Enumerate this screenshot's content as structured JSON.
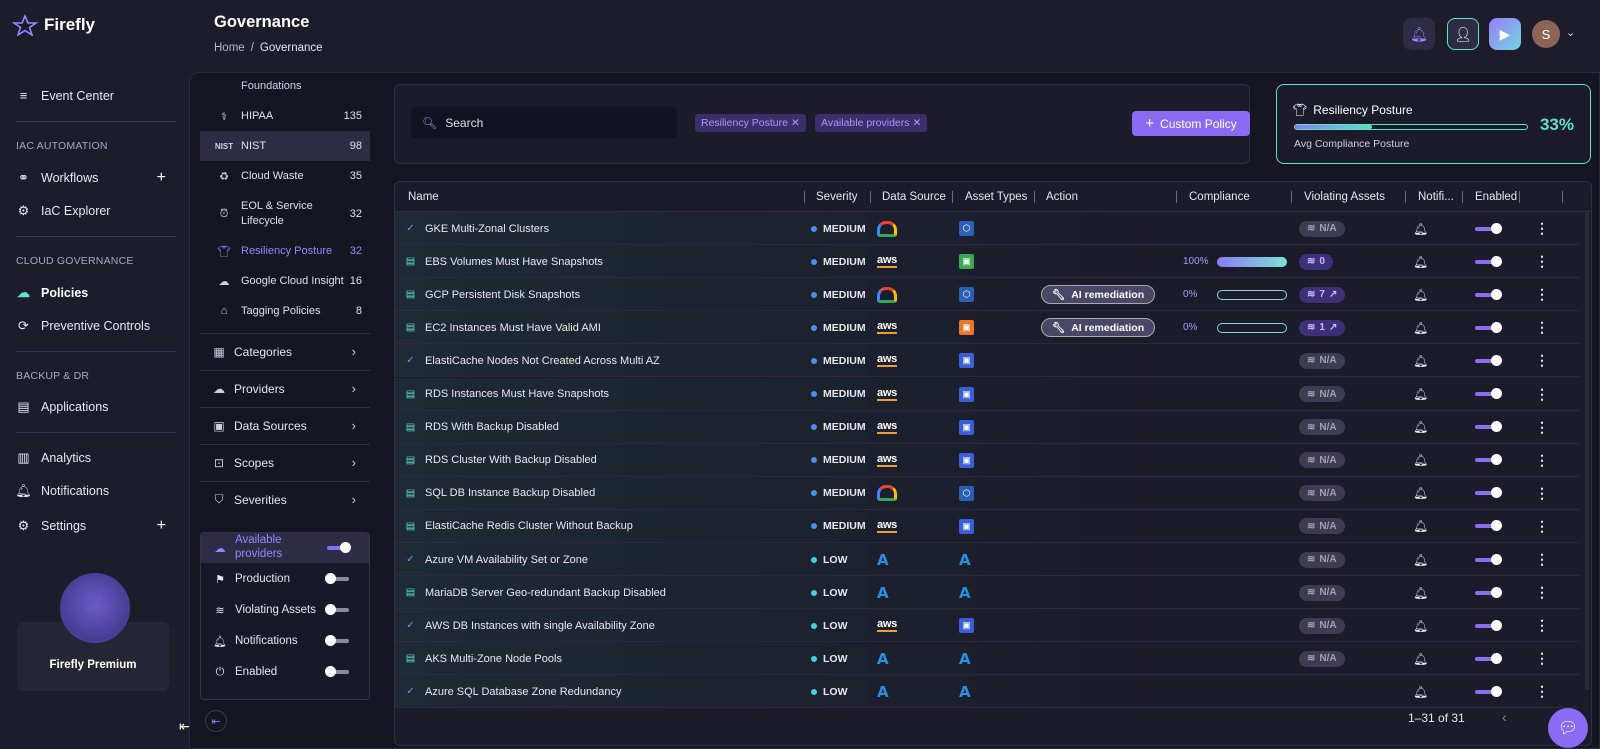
{
  "brand": {
    "name": "Firefly"
  },
  "nav": {
    "event_center": "Event Center",
    "sec_iac": "IAC AUTOMATION",
    "workflows": "Workflows",
    "iac_explorer": "IaC Explorer",
    "sec_cloud": "CLOUD GOVERNANCE",
    "policies": "Policies",
    "preventive": "Preventive Controls",
    "sec_backup": "BACKUP & DR",
    "applications": "Applications",
    "analytics": "Analytics",
    "notifications": "Notifications",
    "settings": "Settings",
    "premium": "Firefly Premium"
  },
  "header": {
    "title": "Governance",
    "crumb_home": "Home",
    "crumb_sep": "/",
    "crumb_current": "Governance",
    "avatar_letter": "S"
  },
  "frameworks": [
    {
      "label": "Foundations",
      "count": ""
    },
    {
      "label": "HIPAA",
      "count": "135"
    },
    {
      "label": "NIST",
      "count": "98"
    },
    {
      "label": "Cloud Waste",
      "count": "35"
    },
    {
      "label": "EOL & Service Lifecycle",
      "count": "32"
    },
    {
      "label": "Resiliency Posture",
      "count": "32"
    },
    {
      "label": "Google Cloud Insight",
      "count": "16"
    },
    {
      "label": "Tagging Policies",
      "count": "8"
    }
  ],
  "categories": [
    "Categories",
    "Providers",
    "Data Sources",
    "Scopes",
    "Severities"
  ],
  "toggles": {
    "available_providers": "Available providers",
    "production": "Production",
    "violating_assets": "Violating Assets",
    "notifications": "Notifications",
    "enabled": "Enabled"
  },
  "search": {
    "placeholder": "Search"
  },
  "chips": [
    "Resiliency Posture",
    "Available providers"
  ],
  "custom_policy": "Custom Policy",
  "resiliency": {
    "title": "Resiliency Posture",
    "percent": "33%",
    "value": 0.33,
    "subtitle": "Avg Compliance Posture"
  },
  "table": {
    "headers": [
      "Name",
      "Severity",
      "Data Source",
      "Asset Types",
      "Action",
      "Compliance",
      "Violating Assets",
      "Notifi...",
      "Enabled"
    ],
    "rows": [
      {
        "name": "GKE Multi-Zonal Clusters",
        "severity": "MEDIUM",
        "ds": "gcp",
        "checked": true,
        "action": "",
        "compliance": "",
        "violating": "N/A"
      },
      {
        "name": "EBS Volumes Must Have Snapshots",
        "severity": "MEDIUM",
        "ds": "aws",
        "checked": false,
        "action": "",
        "compliance": "100%",
        "compliance_value": 1.0,
        "violating": "0"
      },
      {
        "name": "GCP Persistent Disk Snapshots",
        "severity": "MEDIUM",
        "ds": "gcp",
        "checked": false,
        "action": "AI remediation",
        "compliance": "0%",
        "compliance_value": 0,
        "violating": "7"
      },
      {
        "name": "EC2 Instances Must Have Valid AMI",
        "severity": "MEDIUM",
        "ds": "aws",
        "checked": false,
        "action": "AI remediation",
        "compliance": "0%",
        "compliance_value": 0,
        "violating": "1"
      },
      {
        "name": "ElastiCache Nodes Not Created Across Multi AZ",
        "severity": "MEDIUM",
        "ds": "aws",
        "checked": true,
        "action": "",
        "compliance": "",
        "violating": "N/A"
      },
      {
        "name": "RDS Instances Must Have Snapshots",
        "severity": "MEDIUM",
        "ds": "aws",
        "checked": false,
        "action": "",
        "compliance": "",
        "violating": "N/A"
      },
      {
        "name": "RDS With Backup Disabled",
        "severity": "MEDIUM",
        "ds": "aws",
        "checked": false,
        "action": "",
        "compliance": "",
        "violating": "N/A"
      },
      {
        "name": "RDS Cluster With Backup Disabled",
        "severity": "MEDIUM",
        "ds": "aws",
        "checked": false,
        "action": "",
        "compliance": "",
        "violating": "N/A"
      },
      {
        "name": "SQL DB Instance Backup Disabled",
        "severity": "MEDIUM",
        "ds": "gcp",
        "checked": false,
        "action": "",
        "compliance": "",
        "violating": "N/A"
      },
      {
        "name": "ElastiCache Redis Cluster Without Backup",
        "severity": "MEDIUM",
        "ds": "aws",
        "checked": false,
        "action": "",
        "compliance": "",
        "violating": "N/A"
      },
      {
        "name": "Azure VM Availability Set or Zone",
        "severity": "LOW",
        "ds": "azure",
        "checked": true,
        "action": "",
        "compliance": "",
        "violating": "N/A"
      },
      {
        "name": "MariaDB Server Geo-redundant Backup Disabled",
        "severity": "LOW",
        "ds": "azure",
        "checked": false,
        "action": "",
        "compliance": "",
        "violating": "N/A"
      },
      {
        "name": "AWS DB Instances with single Availability Zone",
        "severity": "LOW",
        "ds": "aws",
        "checked": true,
        "action": "",
        "compliance": "",
        "violating": "N/A"
      },
      {
        "name": "AKS Multi-Zone Node Pools",
        "severity": "LOW",
        "ds": "azure",
        "checked": false,
        "action": "",
        "compliance": "",
        "violating": "N/A"
      },
      {
        "name": "Azure SQL Database Zone Redundancy",
        "severity": "LOW",
        "ds": "azure",
        "checked": true,
        "action": "",
        "compliance": "",
        "violating": ""
      }
    ]
  },
  "pagination": {
    "range": "1–31 of 31"
  },
  "colors": {
    "accent": "#8a6cf4",
    "teal": "#5fe0c8",
    "medium": "#4a8fe8",
    "low": "#3fd3e0"
  }
}
